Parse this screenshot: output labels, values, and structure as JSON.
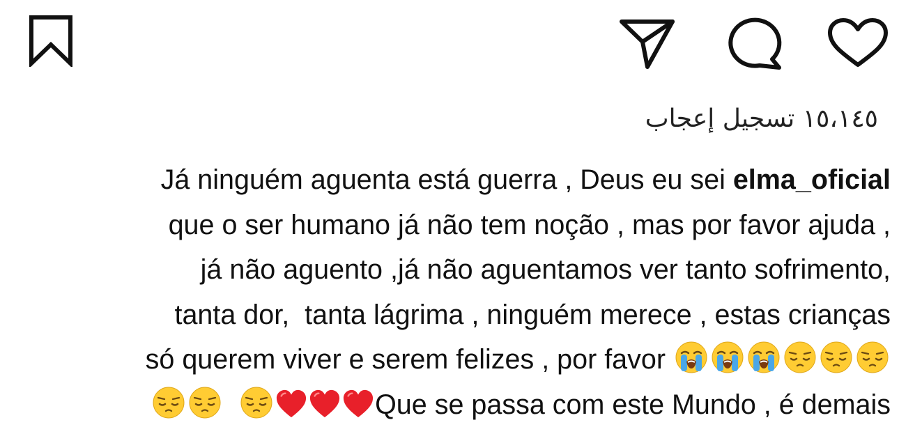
{
  "actions": {
    "save_icon": "bookmark-icon",
    "share_icon": "paper-plane-icon",
    "comment_icon": "speech-bubble-icon",
    "like_icon": "heart-outline-icon"
  },
  "likes": {
    "text": "١٥،١٤٥ تسجيل إعجاب"
  },
  "caption": {
    "line1_text": "Já ninguém aguenta está guerra , Deus eu sei ",
    "username": "elma_oficial",
    "line2_text": "que o ser humano já não tem noção , mas por favor ajuda ,",
    "line3_text": "já não aguento ,já não aguentamos ver tanto sofrimento,",
    "line4_text": "tanta dor,  tanta lágrima , ninguém merece , estas crianças",
    "line5_text": "só querem viver e serem felizes , por favor ",
    "line6_text": "Que se passa com este Mundo , é demais",
    "line5_emojis": [
      "loudly-crying-face",
      "loudly-crying-face",
      "loudly-crying-face",
      "pensive-face",
      "pensive-face",
      "pensive-face"
    ],
    "line6_emojis": [
      "pensive-face",
      "pensive-face",
      "pensive-face",
      "red-heart",
      "red-heart",
      "red-heart"
    ]
  },
  "colors": {
    "icon_stroke": "#111111",
    "background": "#ffffff",
    "text": "#111111",
    "emoji_yellow": "#ffcc33",
    "tears_blue": "#4aa7e8",
    "heart_red": "#e8202a"
  }
}
